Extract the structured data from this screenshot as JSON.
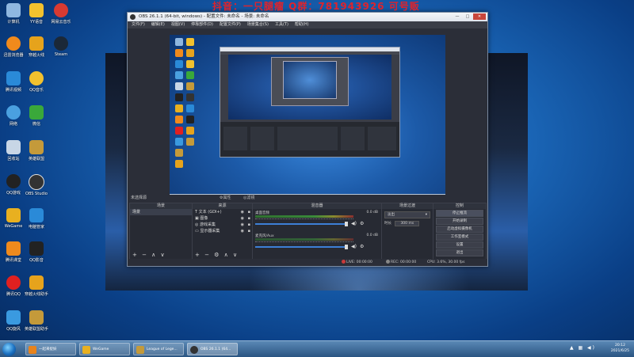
{
  "desktop": {
    "icons": [
      {
        "label": "计算机",
        "color": "#8fb7e0"
      },
      {
        "label": "YY语音",
        "color": "#f2c12e"
      },
      {
        "label": "网易云音乐",
        "color": "#d83a32"
      },
      {
        "label": "迅雷浏览器",
        "color": "#f08a1c"
      },
      {
        "label": "穿越火线",
        "color": "#e6a31c"
      },
      {
        "label": "Steam",
        "color": "#1b2838"
      },
      {
        "label": "腾讯视频",
        "color": "#2a8ad8"
      },
      {
        "label": "QQ音乐",
        "color": "#f2c12e"
      },
      {
        "label": "网络",
        "color": "#4aa0e0"
      },
      {
        "label": "微信",
        "color": "#3aa83a"
      },
      {
        "label": "回收站",
        "color": "#c8d6e6"
      },
      {
        "label": "英雄联盟",
        "color": "#c49a3a"
      },
      {
        "label": "QQ游戏",
        "color": "#222"
      },
      {
        "label": "OBS Studio",
        "color": "#333"
      },
      {
        "label": "WeGame",
        "color": "#e8b020"
      },
      {
        "label": "电脑管家",
        "color": "#2a8ad8"
      },
      {
        "label": "腾讯课堂",
        "color": "#f08a1c"
      },
      {
        "label": "QQ影音",
        "color": "#222"
      },
      {
        "label": "腾讯QQ",
        "color": "#e02020"
      },
      {
        "label": "穿越火线助手",
        "color": "#e6a31c"
      },
      {
        "label": "QQ旋风",
        "color": "#3a9ae0"
      },
      {
        "label": "英雄联盟助手",
        "color": "#c49a3a"
      }
    ]
  },
  "overlay_text": "抖音：一只腿瘤  Q群：781943926  可号贩",
  "obs": {
    "title": "OBS 26.1.1 (64-bit, windows) - 配置文件: 未命名 - 场景: 未命名",
    "win_buttons": {
      "min": "—",
      "max": "□",
      "close": "✕"
    },
    "menu": [
      "文件(F)",
      "编辑(E)",
      "视图(V)",
      "停靠部件(D)",
      "配置文件(P)",
      "场景集合(S)",
      "工具(T)",
      "帮助(H)"
    ],
    "scene_label": "未选择源",
    "properties_label": "⚙属性",
    "filters_label": "◎滤镜",
    "docks": {
      "scenes": {
        "title": "场景",
        "items": [
          "场景"
        ],
        "footer": "+ − ∧ ∨"
      },
      "sources": {
        "title": "来源",
        "items": [
          {
            "icon": "T",
            "label": "文本 (GDI+)"
          },
          {
            "icon": "▣",
            "label": "图像"
          },
          {
            "icon": "◎",
            "label": "游戏采集"
          },
          {
            "icon": "▭",
            "label": "显示器采集"
          }
        ],
        "footer": "+ − ⚙ ∧ ∨"
      },
      "mixer": {
        "title": "混音器",
        "channels": [
          {
            "name": "桌面音频",
            "db": "0.0 dB"
          },
          {
            "name": "麦克风/Aux",
            "db": "0.0 dB"
          }
        ]
      },
      "transitions": {
        "title": "场景过渡",
        "type": "淡出",
        "duration_label": "时长",
        "duration": "300 ms"
      },
      "controls": {
        "title": "控制",
        "buttons": [
          "停止推流",
          "开始录制",
          "启动虚拟摄像机",
          "工作室模式",
          "设置",
          "退出"
        ]
      }
    },
    "status": {
      "live": "LIVE: 00:00:00",
      "rec": "REC: 00:00:00",
      "cpu": "CPU: 3.6%, 30.00 fps"
    }
  },
  "taskbar": {
    "items": [
      {
        "label": "一起来捉妖",
        "color": "#e8831c"
      },
      {
        "label": "WeGame",
        "color": "#e8b020"
      },
      {
        "label": "League of Lege...",
        "color": "#c49a3a"
      },
      {
        "label": "OBS 26.1.1 (64...",
        "color": "#333"
      }
    ],
    "time": "20:12",
    "date": "2021/6/25"
  }
}
